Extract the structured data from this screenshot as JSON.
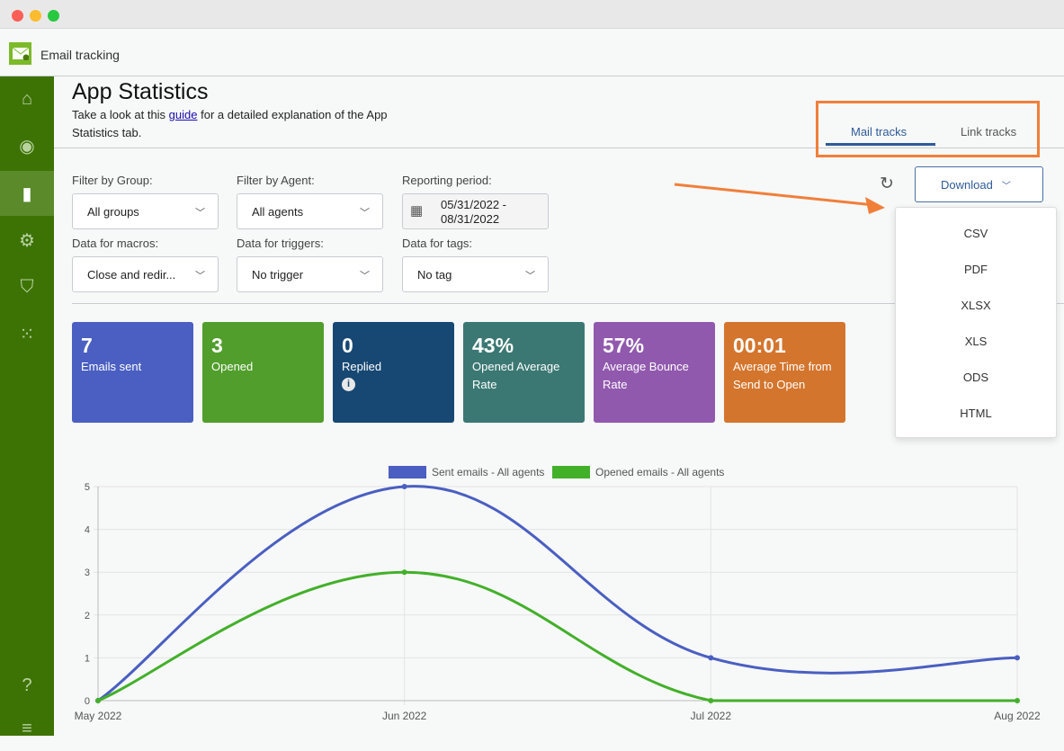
{
  "window": {
    "title": ""
  },
  "app": {
    "name": "Email tracking"
  },
  "sidebar": {
    "items": [
      {
        "icon": "home-icon"
      },
      {
        "icon": "eye-tracking-icon"
      },
      {
        "icon": "bar-chart-icon",
        "active": true
      },
      {
        "icon": "gear-icon"
      },
      {
        "icon": "shield-check-icon"
      },
      {
        "icon": "apps-grid-icon"
      },
      {
        "icon": "help-icon"
      },
      {
        "icon": "menu-icon"
      }
    ]
  },
  "page": {
    "title": "App Statistics",
    "subtitle_pre": "Take a look at this ",
    "subtitle_link": "guide",
    "subtitle_post": " for a detailed explanation of the App Statistics tab."
  },
  "tabs": [
    {
      "label": "Mail tracks",
      "active": true
    },
    {
      "label": "Link tracks"
    }
  ],
  "filters": {
    "group": {
      "label": "Filter by Group:",
      "value": "All groups"
    },
    "agent": {
      "label": "Filter by Agent:",
      "value": "All agents"
    },
    "period": {
      "label": "Reporting period:",
      "value": "05/31/2022 - 08/31/2022"
    },
    "macros": {
      "label": "Data for macros:",
      "value": "Close and redir..."
    },
    "triggers": {
      "label": "Data for triggers:",
      "value": "No trigger"
    },
    "tags": {
      "label": "Data for tags:",
      "value": "No tag"
    }
  },
  "download": {
    "label": "Download",
    "options": [
      "CSV",
      "PDF",
      "XLSX",
      "XLS",
      "ODS",
      "HTML"
    ]
  },
  "cards": [
    {
      "value": "7",
      "label": "Emails sent",
      "color": "#4a5fc1"
    },
    {
      "value": "3",
      "label": "Opened",
      "color": "#519e2c"
    },
    {
      "value": "0",
      "label": "Replied",
      "color": "#174873",
      "info": true
    },
    {
      "value": "43%",
      "label": "Opened Average Rate",
      "color": "#3b7873"
    },
    {
      "value": "57%",
      "label": "Average Bounce Rate",
      "color": "#9159ae"
    },
    {
      "value": "00:01",
      "label": "Average Time from Send to Open",
      "color": "#d4752d"
    }
  ],
  "chart_data": {
    "type": "line",
    "categories": [
      "May 2022",
      "Jun 2022",
      "Jul 2022",
      "Aug 2022"
    ],
    "series": [
      {
        "name": "Sent emails - All agents",
        "values": [
          0,
          5,
          1,
          1
        ],
        "color": "#4a5fc1"
      },
      {
        "name": "Opened emails - All agents",
        "values": [
          0,
          3,
          0,
          0
        ],
        "color": "#43b02a"
      }
    ],
    "ylim": [
      0,
      5
    ],
    "yticks": [
      "0",
      "1",
      "2",
      "3",
      "4",
      "5"
    ],
    "grid": true,
    "legend": "top",
    "smooth": true
  }
}
